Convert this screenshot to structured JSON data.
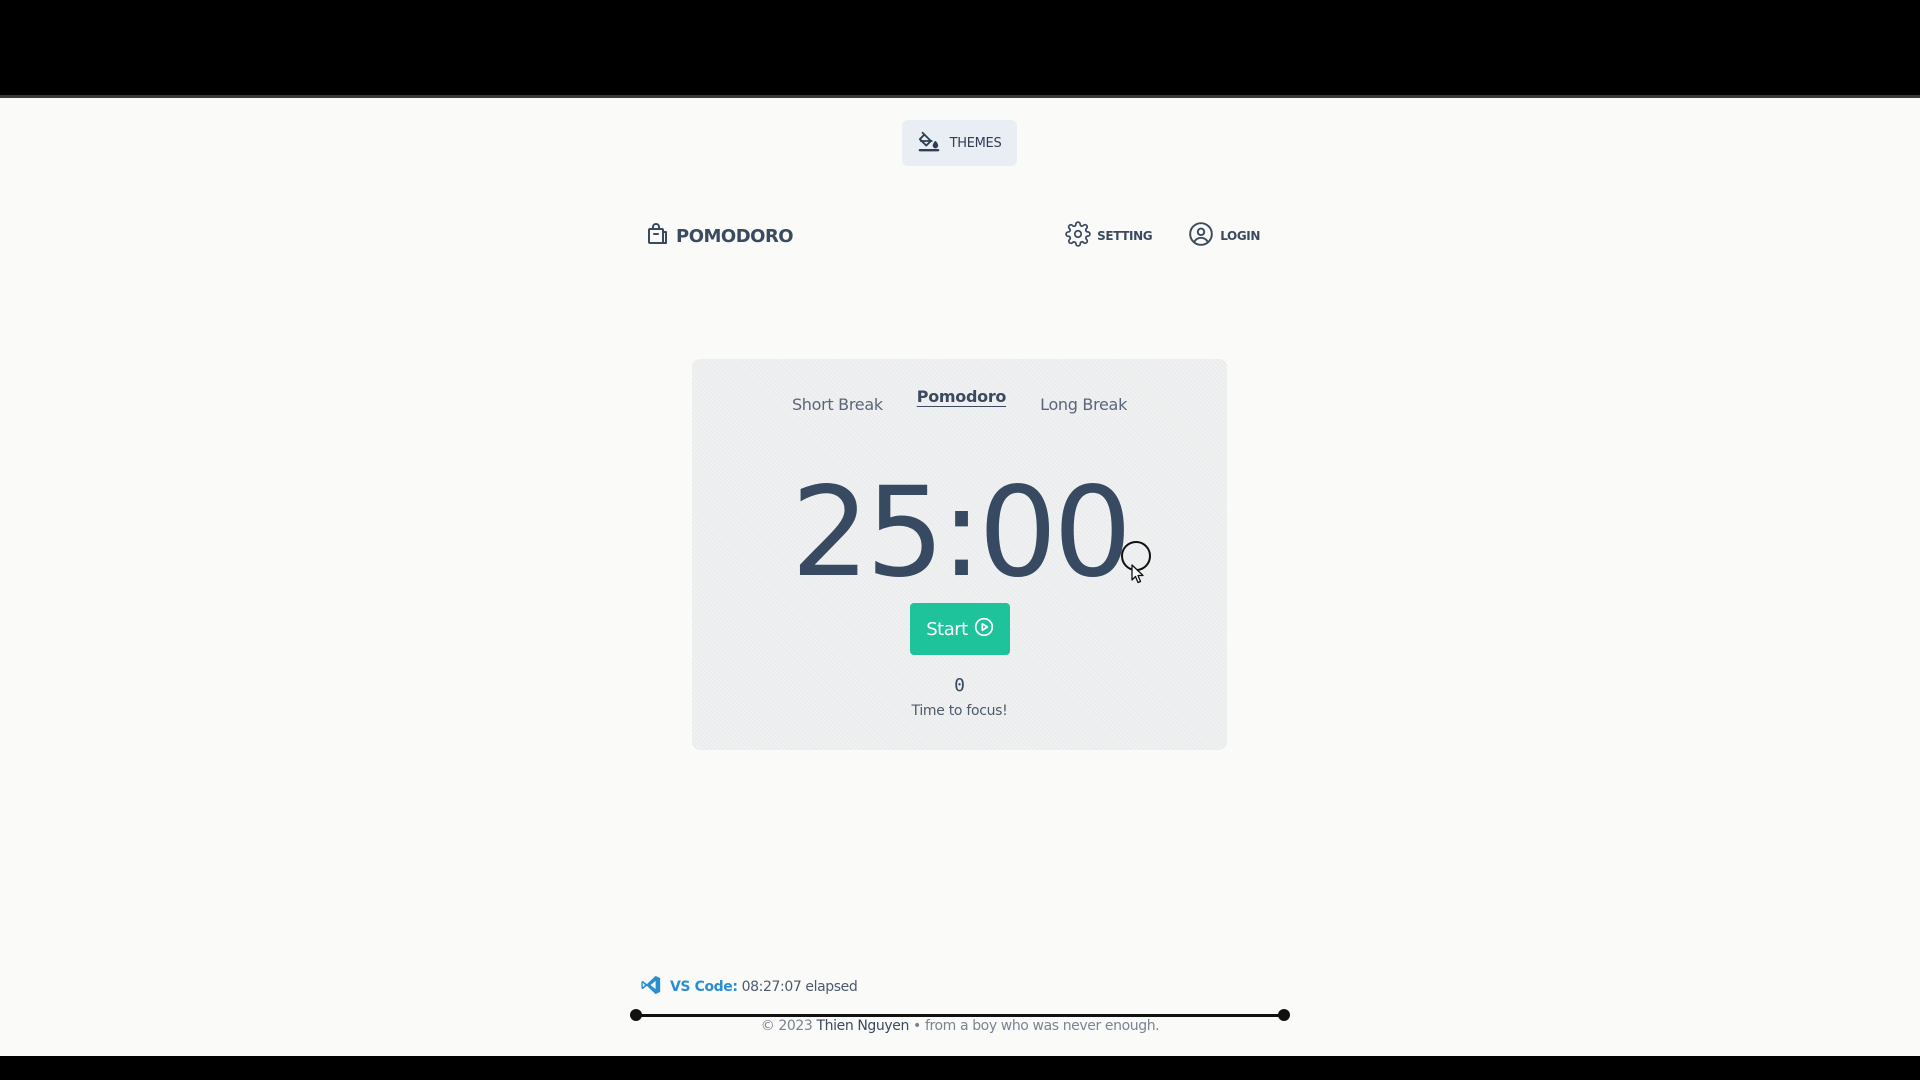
{
  "themes_button": {
    "label": "THEMES",
    "icon": "paint-bucket-icon"
  },
  "header": {
    "logo_text": "POMODORO",
    "logo_icon": "shopping-bag-icon",
    "nav": [
      {
        "label": "SETTING",
        "icon": "gear-icon"
      },
      {
        "label": "LOGIN",
        "icon": "user-circle-icon"
      }
    ]
  },
  "timer_card": {
    "tabs": [
      {
        "label": "Short Break",
        "active": false
      },
      {
        "label": "Pomodoro",
        "active": true
      },
      {
        "label": "Long Break",
        "active": false
      }
    ],
    "time": "25:00",
    "start_button": {
      "label": "Start",
      "icon": "play-circle-icon"
    },
    "count": "0",
    "message": "Time to focus!"
  },
  "status": {
    "app": "VS Code",
    "separator": ":",
    "elapsed": "08:27:07 elapsed",
    "icon": "vscode-icon"
  },
  "footer": {
    "prefix": "© 2023",
    "author": "Thien Nguyen",
    "suffix": "• from a boy who was never enough."
  },
  "colors": {
    "accent": "#1ec39c",
    "text": "#384a62",
    "background": "#fafaf9",
    "card": "#ebeced",
    "link": "#2a8fd0"
  }
}
